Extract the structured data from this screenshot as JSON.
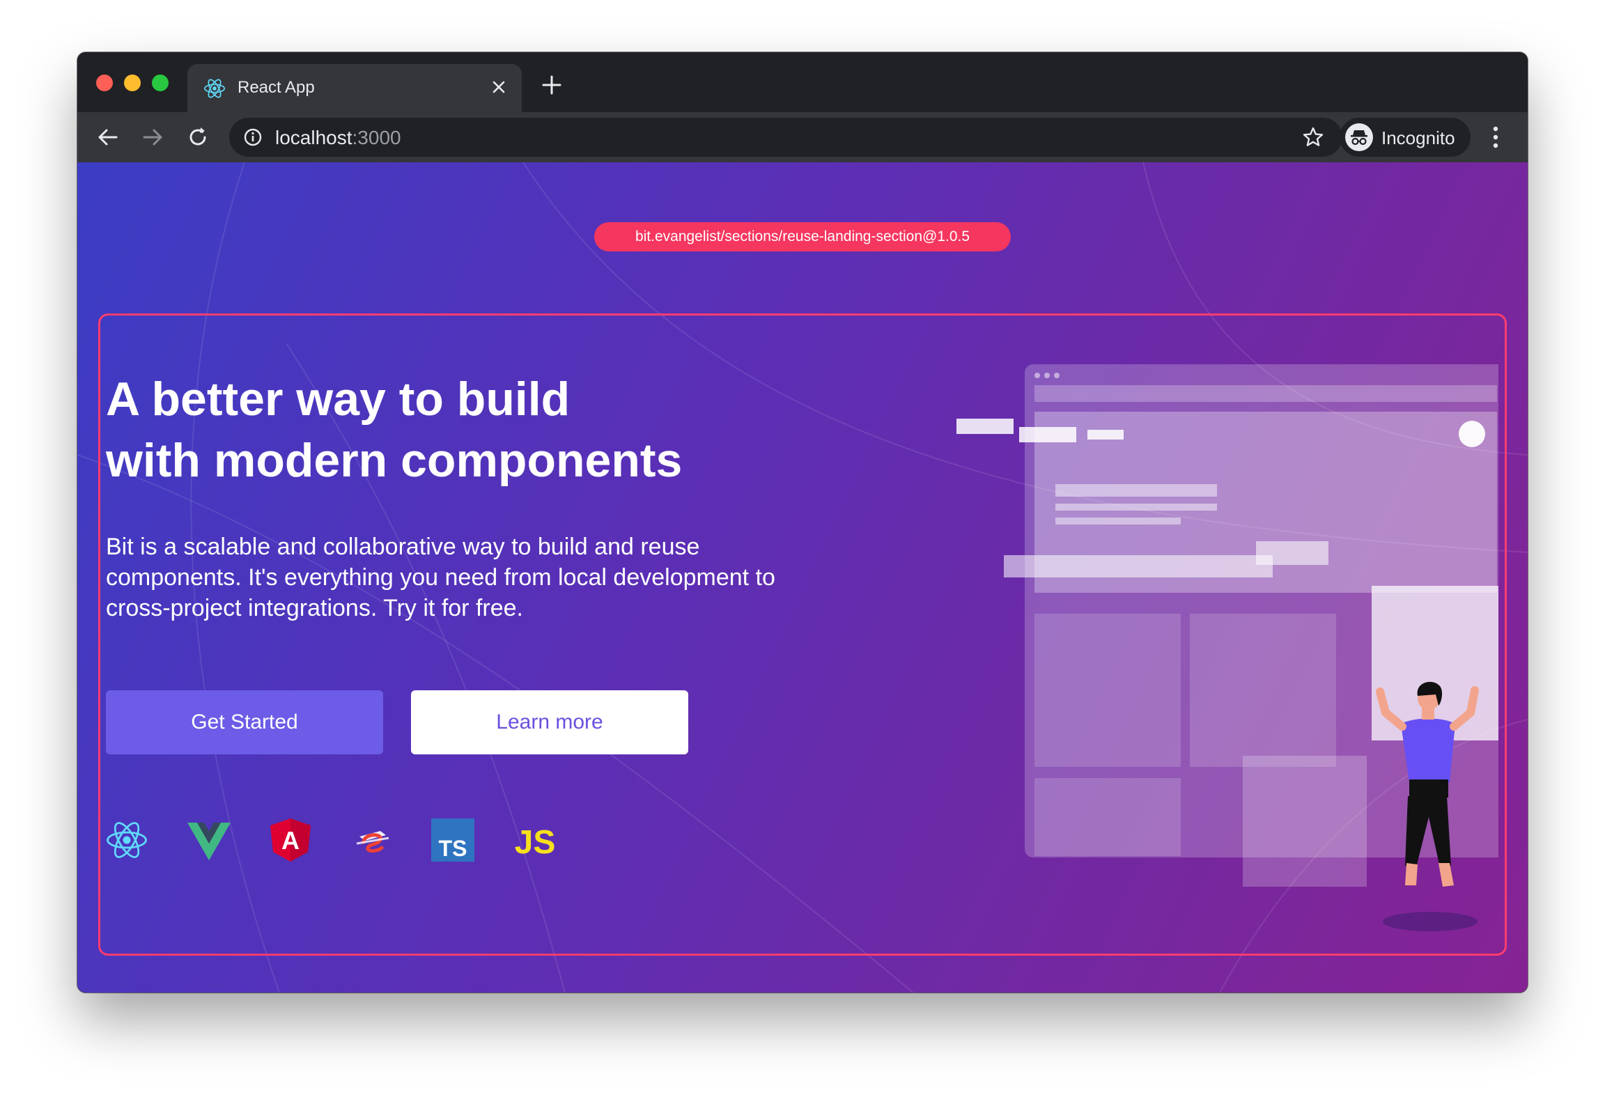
{
  "browser": {
    "tab_title": "React App",
    "url_host": "localhost",
    "url_port": ":3000",
    "profile_label": "Incognito"
  },
  "page": {
    "component_badge": "bit.evangelist/sections/reuse-landing-section@1.0.5",
    "headline_line1": "A better way to build",
    "headline_line2": "with modern components",
    "description": "Bit is a scalable and collaborative way to build and reuse components. It's everything you need from local development to cross-project integrations. Try it for free.",
    "primary_button": "Get Started",
    "secondary_button": "Learn more",
    "framework_logos": [
      {
        "name": "react-logo",
        "text": ""
      },
      {
        "name": "vue-logo",
        "text": ""
      },
      {
        "name": "angular-logo",
        "text": "A"
      },
      {
        "name": "stencil-logo",
        "text": ""
      },
      {
        "name": "typescript-logo",
        "text": "TS"
      },
      {
        "name": "javascript-logo",
        "text": "JS"
      }
    ]
  },
  "colors": {
    "badge": "#f5365f",
    "frame_border": "#ff3d6e",
    "primary_button": "#6c5ce7",
    "gradient_start": "#3b3dc4",
    "gradient_end": "#862394"
  }
}
